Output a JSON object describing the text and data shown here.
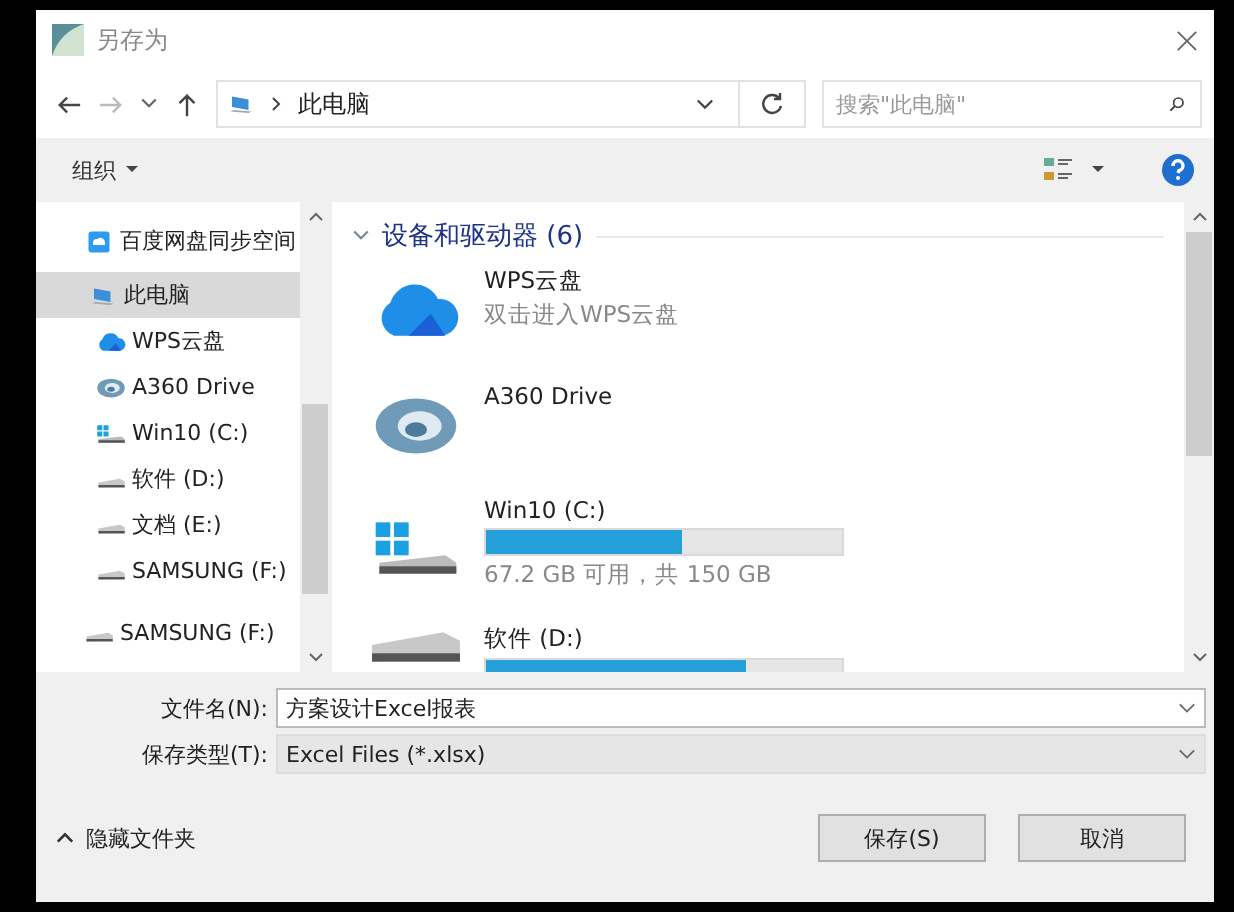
{
  "window": {
    "title": "另存为"
  },
  "address": {
    "path": "此电脑",
    "search_placeholder": "搜索\"此电脑\""
  },
  "toolbar": {
    "organize": "组织"
  },
  "sidebar": {
    "items": [
      {
        "label": "百度网盘同步空间",
        "kind": "syncfolder",
        "selected": false
      },
      {
        "label": "此电脑",
        "kind": "computer",
        "selected": true,
        "children": [
          {
            "label": "WPS云盘",
            "kind": "cloud",
            "selected": false
          },
          {
            "label": "A360 Drive",
            "kind": "swirl",
            "selected": false
          },
          {
            "label": "Win10 (C:)",
            "kind": "systemdrive",
            "selected": false
          },
          {
            "label": "软件 (D:)",
            "kind": "drive",
            "selected": false
          },
          {
            "label": "文档 (E:)",
            "kind": "drive",
            "selected": false
          },
          {
            "label": "SAMSUNG (F:)",
            "kind": "drive",
            "selected": false
          }
        ]
      },
      {
        "label": "SAMSUNG (F:)",
        "kind": "drive",
        "selected": false
      }
    ]
  },
  "content": {
    "group": "设备和驱动器 (6)",
    "items": [
      {
        "kind": "cloud",
        "name": "WPS云盘",
        "detail": "双击进入WPS云盘"
      },
      {
        "kind": "swirl",
        "name": "A360 Drive"
      },
      {
        "kind": "systemdrive",
        "name": "Win10 (C:)",
        "level": 0.55,
        "detail": "67.2 GB 可用，共 150 GB"
      },
      {
        "kind": "drive",
        "name": "软件 (D:)",
        "level": 0.73
      }
    ]
  },
  "form": {
    "filename_label": "文件名(N):",
    "filename": "方案设计Excel报表",
    "type_label": "保存类型(T):",
    "type": "Excel Files (*.xlsx)"
  },
  "footer": {
    "hide_folders": "隐藏文件夹",
    "buttons": [
      "保存(S)",
      "取消"
    ]
  }
}
